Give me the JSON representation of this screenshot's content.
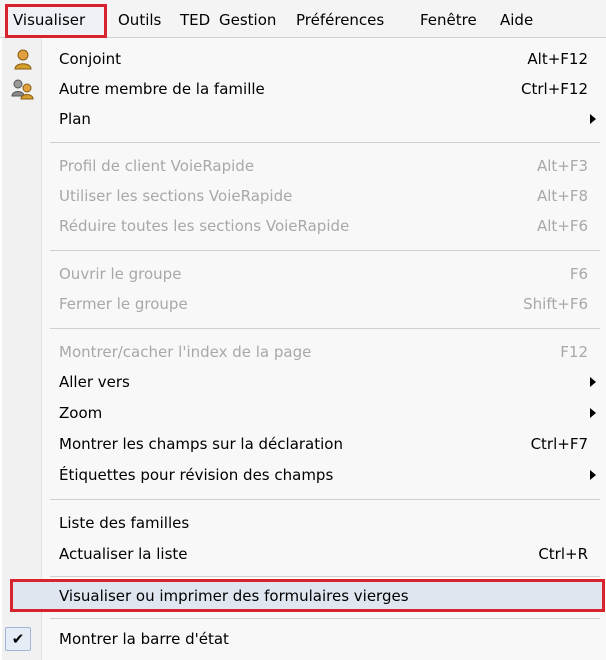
{
  "menubar": {
    "items": [
      "Visualiser",
      "Outils",
      "TED",
      "Gestion",
      "Préférences",
      "Fenêtre",
      "Aide"
    ]
  },
  "menu": {
    "items": [
      {
        "label": "Conjoint",
        "shortcut": "Alt+F12",
        "enabled": true,
        "icon": "spouse-icon"
      },
      {
        "label": "Autre membre de la famille",
        "shortcut": "Ctrl+F12",
        "enabled": true,
        "icon": "family-members-icon"
      },
      {
        "label": "Plan",
        "shortcut": "",
        "enabled": true,
        "submenu": true
      },
      {
        "label": "Profil de client VoieRapide",
        "shortcut": "Alt+F3",
        "enabled": false
      },
      {
        "label": "Utiliser les sections VoieRapide",
        "shortcut": "Alt+F8",
        "enabled": false
      },
      {
        "label": "Réduire toutes les sections VoieRapide",
        "shortcut": "Alt+F6",
        "enabled": false
      },
      {
        "label": "Ouvrir le groupe",
        "shortcut": "F6",
        "enabled": false
      },
      {
        "label": "Fermer le groupe",
        "shortcut": "Shift+F6",
        "enabled": false
      },
      {
        "label": "Montrer/cacher l'index de la page",
        "shortcut": "F12",
        "enabled": false
      },
      {
        "label": "Aller vers",
        "shortcut": "",
        "enabled": true,
        "submenu": true
      },
      {
        "label": "Zoom",
        "shortcut": "",
        "enabled": true,
        "submenu": true
      },
      {
        "label": "Montrer les champs sur la déclaration",
        "shortcut": "Ctrl+F7",
        "enabled": true
      },
      {
        "label": "Étiquettes pour révision des champs",
        "shortcut": "",
        "enabled": true,
        "submenu": true
      },
      {
        "label": "Liste des familles",
        "shortcut": "",
        "enabled": true
      },
      {
        "label": "Actualiser la liste",
        "shortcut": "Ctrl+R",
        "enabled": true
      },
      {
        "label": "Visualiser ou imprimer des formulaires vierges",
        "shortcut": "",
        "enabled": true,
        "highlighted": true
      },
      {
        "label": "Montrer la barre d'état",
        "shortcut": "",
        "enabled": true,
        "checked": true
      }
    ]
  },
  "colors": {
    "highlight_border": "#d8232f",
    "disabled_text": "#a8a8a8",
    "menu_background": "#f8f8f8"
  }
}
